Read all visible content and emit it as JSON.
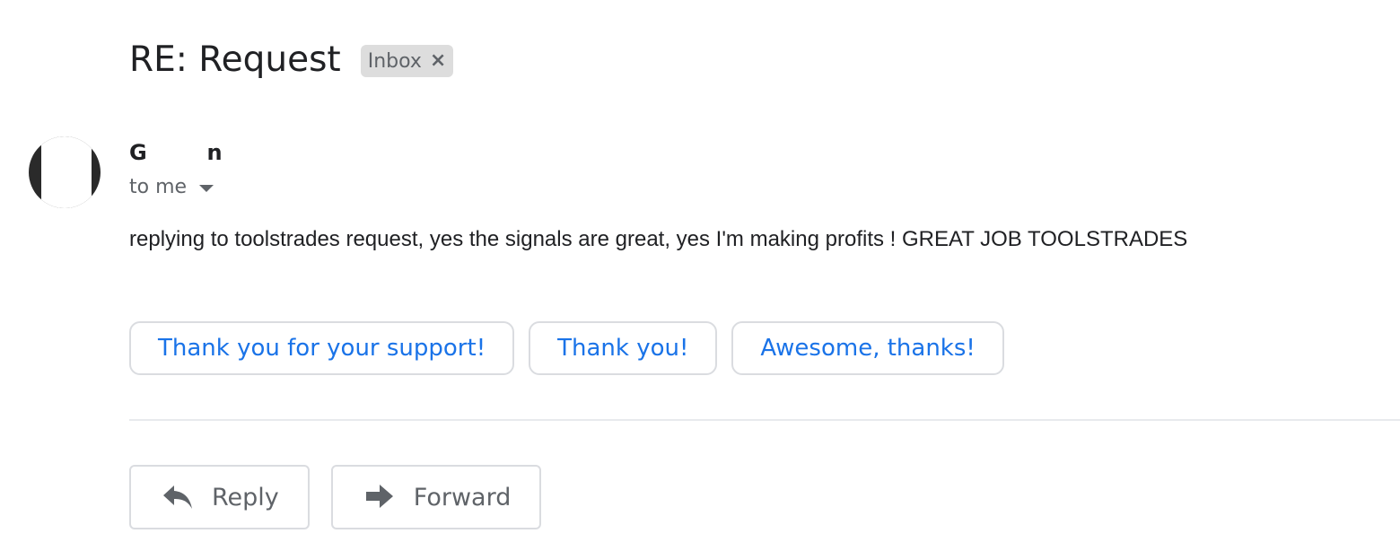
{
  "email": {
    "subject": "RE: Request",
    "label": {
      "text": "Inbox",
      "close_glyph": "×"
    },
    "sender": {
      "name": "G        n",
      "recipient_text": "to me"
    },
    "body": "replying to toolstrades request, yes the signals are great, yes I'm making profits ! GREAT JOB TOOLSTRADES"
  },
  "smart_replies": [
    {
      "label": "Thank you for your support!"
    },
    {
      "label": "Thank you!"
    },
    {
      "label": "Awesome, thanks!"
    }
  ],
  "actions": {
    "reply": {
      "label": "Reply",
      "icon": "reply-icon"
    },
    "forward": {
      "label": "Forward",
      "icon": "forward-icon"
    }
  },
  "colors": {
    "accent": "#1a73e8",
    "text": "#202124",
    "muted": "#5f6368",
    "border": "#dadce0",
    "chip_bg": "#dddddd"
  }
}
